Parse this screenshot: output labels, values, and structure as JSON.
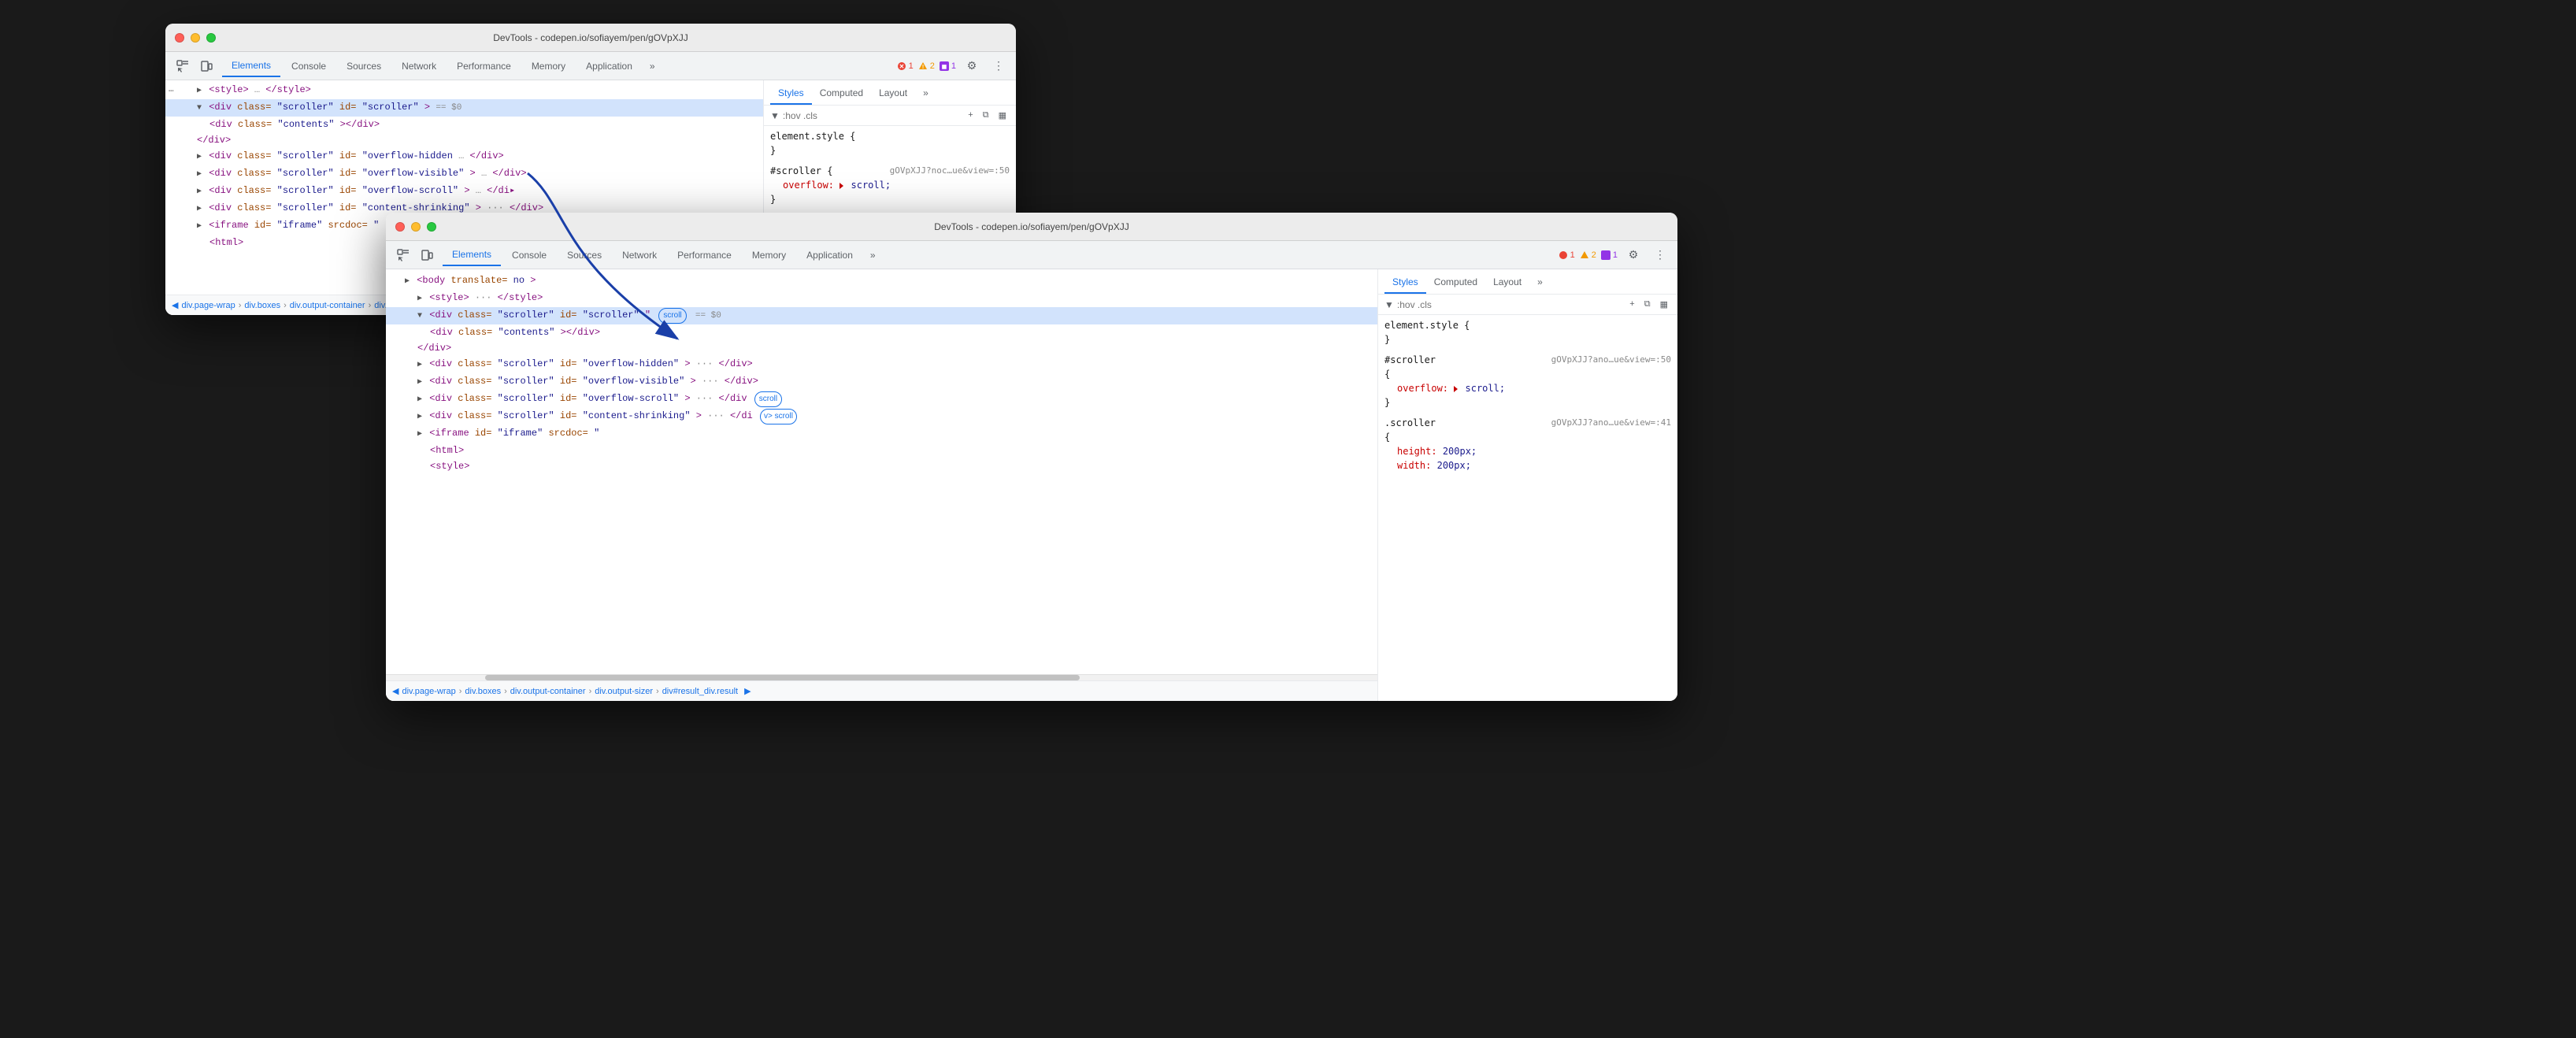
{
  "window1": {
    "title": "DevTools - codepen.io/sofiayem/pen/gOVpXJJ",
    "tabs": [
      "Elements",
      "Console",
      "Sources",
      "Network",
      "Performance",
      "Memory",
      "Application"
    ],
    "active_tab": "Elements",
    "styles_tabs": [
      "Styles",
      "Computed",
      "Layout"
    ],
    "active_style_tab": "Styles",
    "filter_placeholder": ":hov .cls",
    "html_content": [
      {
        "indent": 1,
        "text": "▶ <style> … </style>"
      },
      {
        "indent": 1,
        "text": "▼ <div class=\"scroller\" id=\"scroller\"> == $0",
        "selected": true
      },
      {
        "indent": 2,
        "text": "<div class=\"contents\"></div>"
      },
      {
        "indent": 2,
        "text": "</div>"
      },
      {
        "indent": 1,
        "text": "▶ <div class=\"scroller\" id=\"overflow-hidden …</div>"
      },
      {
        "indent": 1,
        "text": "▶ <div class=\"scroller\" id=\"overflow-visible\"> … </div>"
      },
      {
        "indent": 1,
        "text": "▶ <div class=\"scroller\" id=\"overflow-scroll\"> … </di▸"
      },
      {
        "indent": 1,
        "text": "▶ <div class=\"scroller\" id=\"content-shrinking\"> … </div>"
      },
      {
        "indent": 1,
        "text": "▶ <iframe id=\"iframe\" srcdoc="
      },
      {
        "indent": 2,
        "text": "<html>"
      }
    ],
    "css_rules": [
      {
        "selector": "element.style {",
        "props": [],
        "close": "}"
      },
      {
        "selector": "#scroller {",
        "source": "gOVpXJJ?noc…ue&view=:50",
        "props": [
          {
            "name": "overflow:",
            "value": "▶ scroll;"
          }
        ],
        "close": "}"
      }
    ],
    "breadcrumb": [
      "div.page-wrap",
      "div.boxes",
      "div.output-container",
      "div.outp…"
    ]
  },
  "window2": {
    "title": "DevTools - codepen.io/sofiayem/pen/gOVpXJJ",
    "tabs": [
      "Elements",
      "Console",
      "Sources",
      "Network",
      "Performance",
      "Memory",
      "Application"
    ],
    "active_tab": "Elements",
    "styles_tabs": [
      "Styles",
      "Computed",
      "Layout"
    ],
    "active_style_tab": "Styles",
    "filter_placeholder": ":hov .cls",
    "html_content": [
      {
        "indent": 1,
        "text": "▶ <body translate=no >"
      },
      {
        "indent": 2,
        "text": "▶ <style> … </style>"
      },
      {
        "indent": 2,
        "text": "▼ <div class=\"scroller\" id=\"scroller\"",
        "badge": "scroll",
        "badge2": "== $0",
        "selected": true
      },
      {
        "indent": 3,
        "text": "<div class=\"contents\"></div>"
      },
      {
        "indent": 2,
        "text": "</div>"
      },
      {
        "indent": 2,
        "text": "▶ <div class=\"scroller\" id=\"overflow-hidden\"> … </div>"
      },
      {
        "indent": 2,
        "text": "▶ <div class=\"scroller\" id=\"overflow-visible\"> … </div>"
      },
      {
        "indent": 2,
        "text": "▶ <div class=\"scroller\" id=\"overflow-scroll\"> … </div",
        "badge3": "scroll"
      },
      {
        "indent": 2,
        "text": "▶ <div class=\"scroller\" id=\"content-shrinking\"> … </di",
        "badge4": "v>",
        "badge5": "scroll"
      },
      {
        "indent": 2,
        "text": "▶ <iframe id=\"iframe\" srcdoc="
      },
      {
        "indent": 3,
        "text": "<html>"
      },
      {
        "indent": 3,
        "text": "<style>"
      }
    ],
    "css_rules": [
      {
        "selector": "element.style {",
        "props": [],
        "close": "}"
      },
      {
        "selector": "#scroller",
        "source": "gOVpXJJ?ano…ue&view=:50",
        "selector2": "{",
        "props": [
          {
            "name": "overflow:",
            "value": "▶ scroll;"
          }
        ],
        "close": "}"
      },
      {
        "selector": ".scroller",
        "source": "gOVpXJJ?ano…ue&view=:41",
        "selector2": "{",
        "props": [
          {
            "name": "height:",
            "value": "200px;"
          },
          {
            "name": "width:",
            "value": "200px;"
          }
        ]
      }
    ],
    "breadcrumb": [
      "div.page-wrap",
      "div.boxes",
      "div.output-container",
      "div.output-sizer",
      "div#result_div.result"
    ]
  },
  "status_badges": {
    "error": "1",
    "warning": "2",
    "info": "1"
  }
}
